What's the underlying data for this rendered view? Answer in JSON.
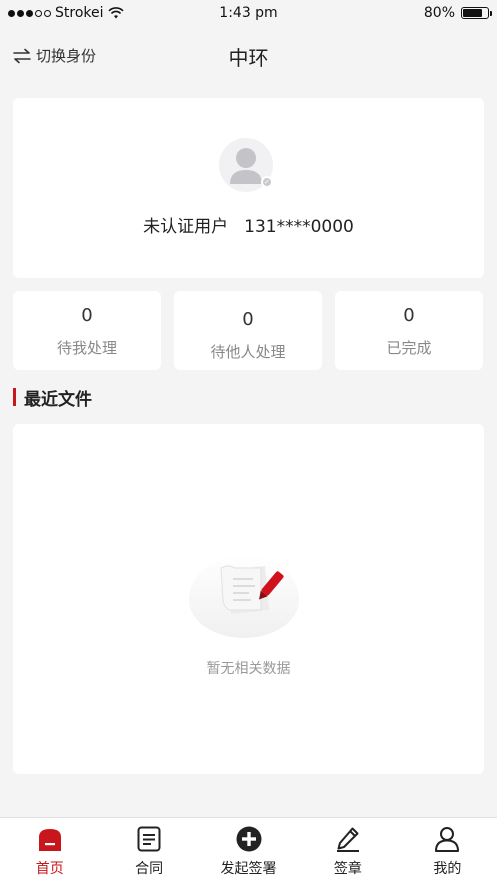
{
  "status_bar": {
    "carrier": "Strokei",
    "time": "1:43 pm",
    "battery_percent": "80%",
    "battery_level": 0.8,
    "signal_bars_filled": 3,
    "signal_bars_total": 5
  },
  "nav": {
    "switch_label": "切换身份",
    "title": "中环"
  },
  "profile": {
    "status": "未认证用户",
    "phone": "131****0000"
  },
  "stats": [
    {
      "count": "0",
      "label": "待我处理"
    },
    {
      "count": "0",
      "label": "待他人处理"
    },
    {
      "count": "0",
      "label": "已完成"
    }
  ],
  "recent": {
    "title": "最近文件",
    "empty_text": "暂无相关数据"
  },
  "tabs": [
    {
      "label": "首页",
      "icon": "home-icon",
      "active": true
    },
    {
      "label": "合同",
      "icon": "contract-icon",
      "active": false
    },
    {
      "label": "发起签署",
      "icon": "plus-circle-icon",
      "active": false
    },
    {
      "label": "签章",
      "icon": "pen-icon",
      "active": false
    },
    {
      "label": "我的",
      "icon": "user-icon",
      "active": false
    }
  ],
  "colors": {
    "accent": "#c8161d",
    "background": "#f4f4f4"
  }
}
